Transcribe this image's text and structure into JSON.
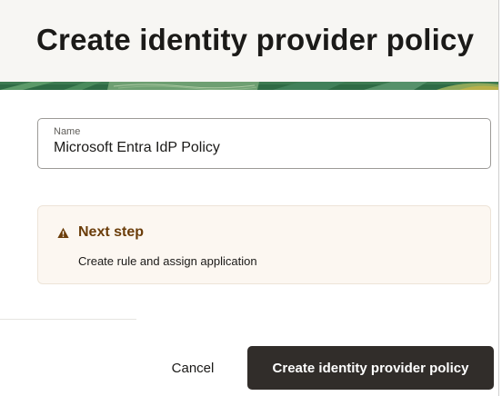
{
  "dialog": {
    "title": "Create identity provider policy"
  },
  "form": {
    "name_label": "Name",
    "name_value": "Microsoft Entra IdP Policy"
  },
  "notice": {
    "icon": "warning-triangle-icon",
    "title": "Next step",
    "text": "Create rule and assign application",
    "colors": {
      "background": "#fcf7f1",
      "title": "#6b3d0a"
    }
  },
  "footer": {
    "cancel_label": "Cancel",
    "primary_label": "Create identity provider policy",
    "colors": {
      "primary_background": "#312d2a"
    }
  },
  "colors": {
    "banner_green": "#2f6b45",
    "header_background": "#f7f6f3"
  }
}
